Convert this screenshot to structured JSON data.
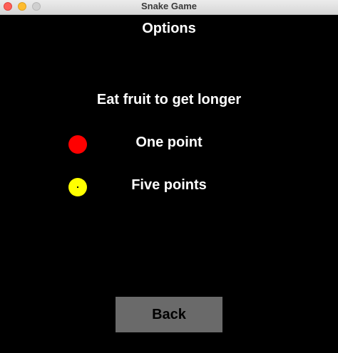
{
  "window": {
    "title": "Snake Game"
  },
  "screen": {
    "heading": "Options",
    "subtitle": "Eat fruit to get longer"
  },
  "legend": [
    {
      "icon": "red-fruit-icon",
      "color": "#ff0000",
      "label": "One point"
    },
    {
      "icon": "yellow-fruit-icon",
      "color": "#ffff00",
      "label": "Five points"
    }
  ],
  "buttons": {
    "back_label": "Back"
  },
  "colors": {
    "background": "#000000",
    "text": "#ffffff",
    "button": "#6a6a6a"
  }
}
